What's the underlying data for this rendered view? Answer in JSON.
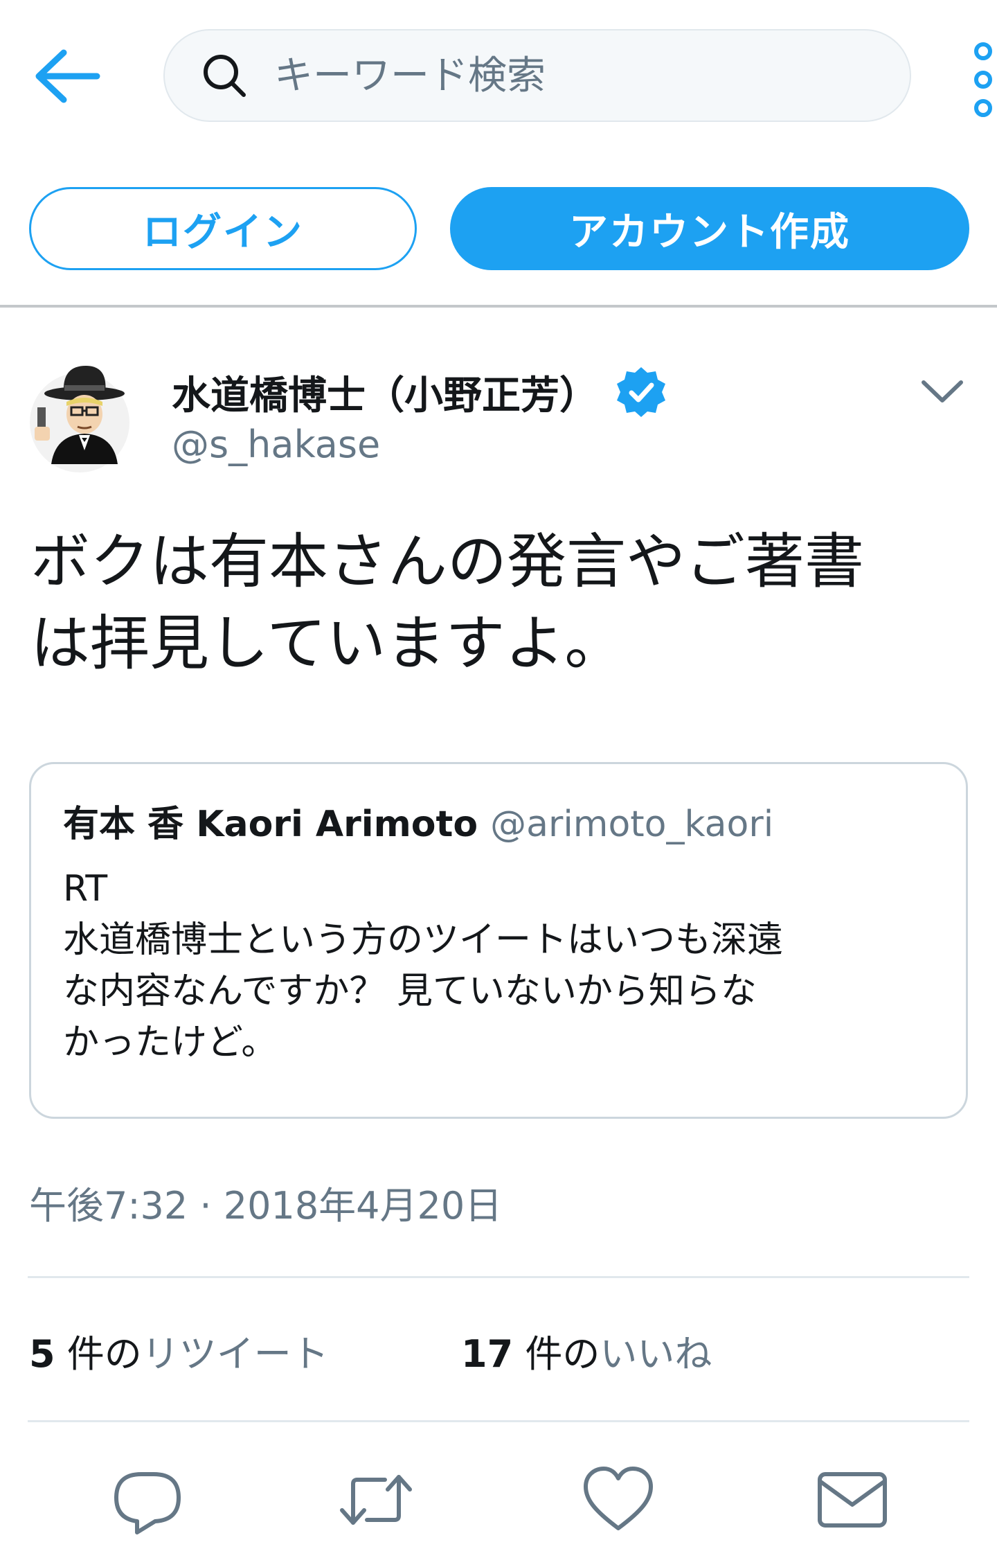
{
  "header": {
    "back_icon": "arrow-left-icon",
    "search_icon": "search-icon",
    "search_placeholder": "キーワード検索",
    "search_value": "",
    "more_icon": "more-vertical-icon"
  },
  "auth": {
    "login_label": "ログイン",
    "signup_label": "アカウント作成"
  },
  "tweet": {
    "author_name": "水道橋博士（小野正芳）",
    "author_handle": "@s_hakase",
    "verified_icon": "verified-badge-icon",
    "caret_icon": "chevron-down-icon",
    "text": "ボクは有本さんの発言やご著書\nは拝見していますよ。",
    "timestamp": "午後7:32 · 2018年4月20日"
  },
  "quoted": {
    "name": "有本 香 Kaori Arimoto",
    "handle": "@arimoto_kaori",
    "text": "RT\n水道橋博士という方のツイートはいつも深遠\nな内容なんですか？ 見ていないから知らな\nかったけど。"
  },
  "stats": {
    "retweets_count": "5",
    "retweets_unit": " 件の",
    "retweets_label": "リツイート",
    "likes_count": "17",
    "likes_unit": " 件の",
    "likes_label": "いいね"
  },
  "actions": {
    "reply_icon": "reply-icon",
    "retweet_icon": "retweet-icon",
    "like_icon": "heart-icon",
    "dm_icon": "envelope-icon"
  },
  "colors": {
    "accent": "#1da1f2",
    "secondary_text": "#657786",
    "primary_text": "#14171a",
    "border": "#e1e8ed"
  }
}
